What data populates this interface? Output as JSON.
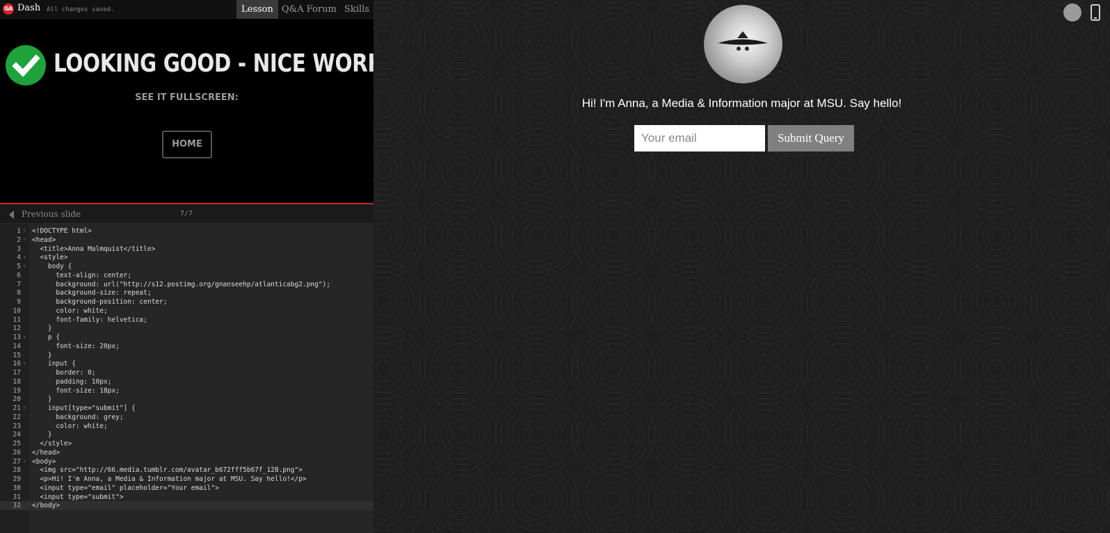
{
  "topbar": {
    "logo": "GA",
    "app_name": "Dash",
    "save_status": "All changes saved.",
    "tabs": [
      "Lesson",
      "Q&A Forum",
      "Skills"
    ]
  },
  "lesson": {
    "success_message": "LOOKING GOOD - NICE WORK!",
    "fullscreen_label": "SEE IT FULLSCREEN:",
    "home_button": "HOME",
    "previous_slide": "Previous slide",
    "slide_counter": "7/7"
  },
  "editor": {
    "line_numbers": [
      "1",
      "2",
      "3",
      "4",
      "5",
      "6",
      "7",
      "8",
      "9",
      "10",
      "11",
      "12",
      "13",
      "14",
      "15",
      "16",
      "17",
      "18",
      "19",
      "20",
      "21",
      "22",
      "23",
      "24",
      "25",
      "26",
      "27",
      "28",
      "29",
      "30",
      "31",
      "32"
    ],
    "lines": [
      "<!DOCTYPE html>",
      "<head>",
      "  <title>Anna Malmquist</title>",
      "  <style>",
      "    body {",
      "      text-align: center;",
      "      background: url(\"http://s12.postimg.org/gnanseehp/atlanticabg2.png\");",
      "      background-size: repeat;",
      "      background-position: center;",
      "      color: white;",
      "      font-family: helvetica;",
      "    }",
      "    p {",
      "      font-size: 20px;",
      "    }",
      "    input {",
      "      border: 0;",
      "      padding: 10px;",
      "      font-size: 18px;",
      "    }",
      "    input[type=\"submit\"] {",
      "      background: grey;",
      "      color: white;",
      "    }",
      "  </style>",
      "</head>",
      "<body>",
      "  <img src=\"http://66.media.tumblr.com/avatar_b672fff5b67f_128.png\">",
      "  <p>Hi! I'm Anna, a Media & Information major at MSU. Say hello!</p>",
      "  <input type=\"email\" placeholder=\"Your email\">",
      "  <input type=\"submit\">",
      "</body>"
    ]
  },
  "preview": {
    "greeting": "Hi! I'm Anna, a Media & Information major at MSU. Say hello!",
    "email_placeholder": "Your email",
    "submit_label": "Submit Query"
  },
  "colors": {
    "accent_red": "#d0262e",
    "success_green": "#1fa23c",
    "submit_grey": "#808080"
  }
}
